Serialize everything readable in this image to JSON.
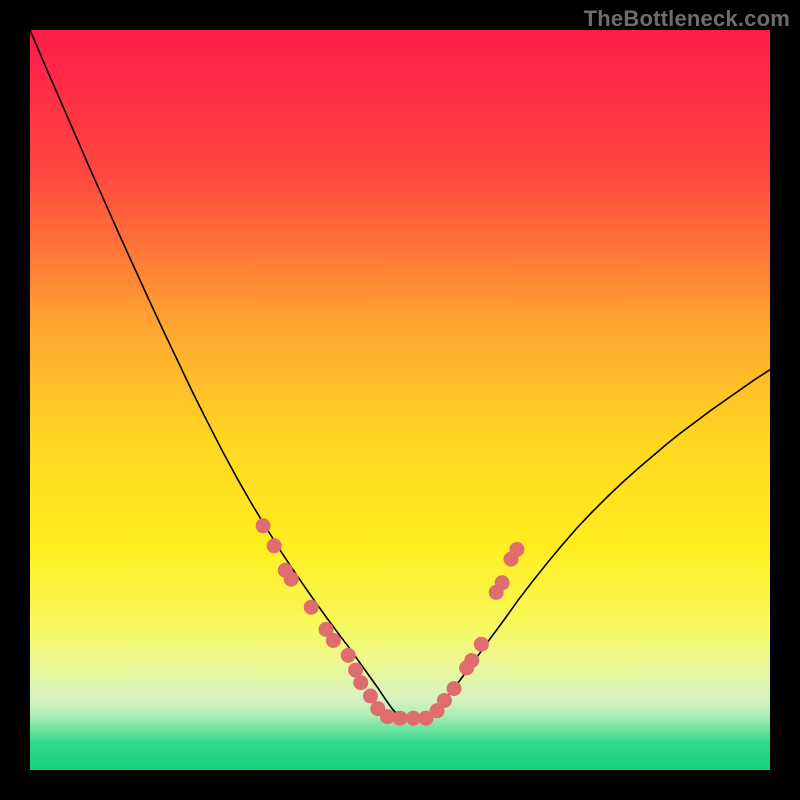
{
  "watermark": "TheBottleneck.com",
  "chart_data": {
    "type": "line",
    "title": "",
    "xlabel": "",
    "ylabel": "",
    "xlim": [
      0,
      100
    ],
    "ylim": [
      0,
      100
    ],
    "background_gradient": {
      "stops": [
        {
          "offset": 0.0,
          "color": "#ff1b4a"
        },
        {
          "offset": 0.2,
          "color": "#ff4a3f"
        },
        {
          "offset": 0.4,
          "color": "#ffa531"
        },
        {
          "offset": 0.55,
          "color": "#ffd521"
        },
        {
          "offset": 0.7,
          "color": "#ffee20"
        },
        {
          "offset": 0.8,
          "color": "#f8f85a"
        },
        {
          "offset": 0.86,
          "color": "#eaf797"
        },
        {
          "offset": 0.905,
          "color": "#d6f3c1"
        },
        {
          "offset": 0.925,
          "color": "#b0ecb8"
        },
        {
          "offset": 0.945,
          "color": "#6fe3a0"
        },
        {
          "offset": 0.965,
          "color": "#2fd98a"
        },
        {
          "offset": 1.0,
          "color": "#17d07e"
        }
      ]
    },
    "curve": {
      "color": "#000000",
      "width": 1.6,
      "x": [
        0,
        2,
        4,
        6,
        8,
        10,
        12,
        14,
        16,
        18,
        20,
        22,
        24,
        26,
        28,
        30,
        32,
        34,
        36,
        38,
        40,
        42,
        43,
        44,
        45,
        46,
        47,
        48,
        49,
        50,
        51,
        52,
        53,
        54,
        55,
        56,
        58,
        60,
        62,
        64,
        66,
        68,
        70,
        72,
        74,
        76,
        78,
        80,
        82,
        84,
        86,
        88,
        90,
        92,
        94,
        96,
        98,
        100
      ],
      "y": [
        100,
        95.3,
        90.7,
        86.1,
        81.5,
        77.0,
        72.5,
        68.1,
        63.7,
        59.4,
        55.2,
        51.0,
        47.0,
        43.1,
        39.4,
        35.9,
        32.6,
        29.4,
        26.4,
        23.5,
        20.7,
        18.0,
        16.7,
        15.3,
        13.9,
        12.5,
        11.1,
        9.6,
        8.2,
        7.1,
        7.0,
        7.0,
        7.0,
        7.1,
        8.1,
        9.4,
        12.0,
        14.7,
        17.5,
        20.2,
        23.0,
        25.6,
        28.1,
        30.5,
        32.8,
        34.9,
        36.9,
        38.8,
        40.6,
        42.3,
        44.0,
        45.6,
        47.1,
        48.6,
        50.0,
        51.4,
        52.8,
        54.1
      ]
    },
    "dots": {
      "color": "#e06d6d",
      "radius": 7.5,
      "points": [
        {
          "x": 31.5,
          "y": 33.0
        },
        {
          "x": 33.0,
          "y": 30.3
        },
        {
          "x": 34.5,
          "y": 27.0
        },
        {
          "x": 35.3,
          "y": 25.8
        },
        {
          "x": 38.0,
          "y": 22.0
        },
        {
          "x": 40.0,
          "y": 19.0
        },
        {
          "x": 41.0,
          "y": 17.5
        },
        {
          "x": 43.0,
          "y": 15.5
        },
        {
          "x": 44.0,
          "y": 13.5
        },
        {
          "x": 44.7,
          "y": 11.8
        },
        {
          "x": 46.0,
          "y": 10.0
        },
        {
          "x": 47.0,
          "y": 8.3
        },
        {
          "x": 48.3,
          "y": 7.2
        },
        {
          "x": 50.0,
          "y": 7.0
        },
        {
          "x": 51.8,
          "y": 7.0
        },
        {
          "x": 53.5,
          "y": 7.0
        },
        {
          "x": 55.0,
          "y": 8.0
        },
        {
          "x": 56.0,
          "y": 9.4
        },
        {
          "x": 57.3,
          "y": 11.0
        },
        {
          "x": 59.0,
          "y": 13.8
        },
        {
          "x": 59.7,
          "y": 14.8
        },
        {
          "x": 61.0,
          "y": 17.0
        },
        {
          "x": 63.0,
          "y": 24.0
        },
        {
          "x": 63.8,
          "y": 25.3
        },
        {
          "x": 65.0,
          "y": 28.5
        },
        {
          "x": 65.8,
          "y": 29.8
        }
      ]
    }
  }
}
